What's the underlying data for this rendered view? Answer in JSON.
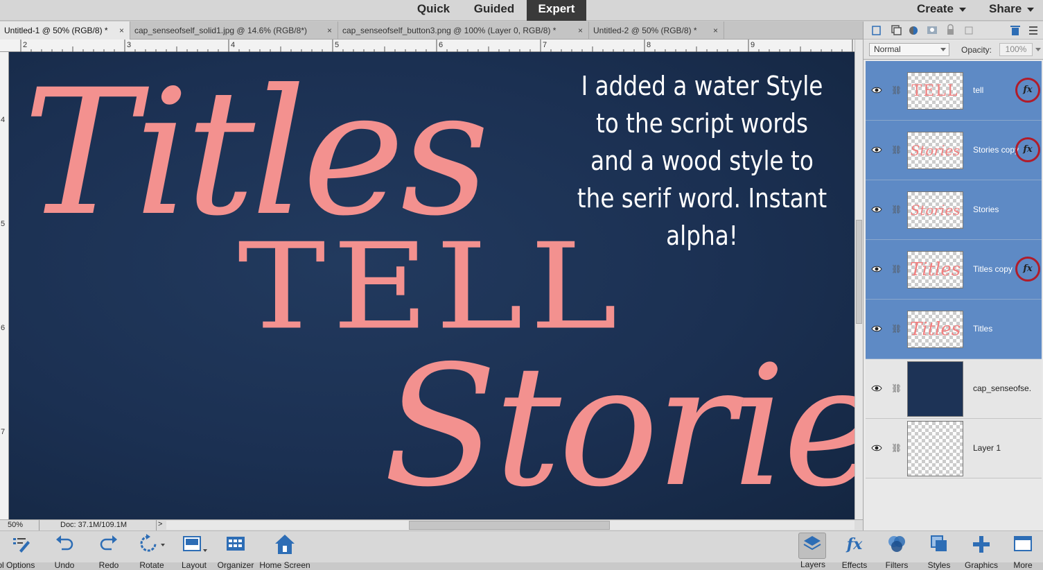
{
  "top": {
    "modes": [
      "Quick",
      "Guided",
      "Expert"
    ],
    "active_mode": "Expert",
    "create": "Create",
    "share": "Share"
  },
  "tabs": [
    {
      "label": "Untitled-1 @ 50% (RGB/8) *",
      "close": "×"
    },
    {
      "label": "cap_senseofself_solid1.jpg @ 14.6% (RGB/8*)",
      "close": "×"
    },
    {
      "label": "cap_senseofself_button3.png @ 100% (Layer 0, RGB/8) *",
      "close": "×"
    },
    {
      "label": "Untitled-2 @ 50% (RGB/8) *",
      "close": "×"
    }
  ],
  "ruler": {
    "top": [
      "2",
      "3",
      "4",
      "5",
      "6",
      "7",
      "8",
      "9"
    ],
    "left": [
      "4",
      "5",
      "6",
      "7"
    ]
  },
  "canvas": {
    "art_titles": "Titles",
    "art_tell": "TELL",
    "art_stories": "Stories",
    "annotation": "I added a water Style to the script words and a wood style to the serif word. Instant alpha!"
  },
  "status": {
    "zoom": "50%",
    "doc": "Doc: 37.1M/109.1M",
    "arrow": ">"
  },
  "layers_panel": {
    "blend_mode": "Normal",
    "opacity_label": "Opacity:",
    "opacity_value": "100%",
    "layers": [
      {
        "name": "tell",
        "thumb": "TELL",
        "selected": true,
        "fx": "fx"
      },
      {
        "name": "Stories copy",
        "thumb": "Stories",
        "selected": true,
        "fx": "fx"
      },
      {
        "name": "Stories",
        "thumb": "Stories",
        "selected": true,
        "fx": ""
      },
      {
        "name": "Titles copy",
        "thumb": "Titles",
        "selected": true,
        "fx": "fx"
      },
      {
        "name": "Titles",
        "thumb": "Titles",
        "selected": true,
        "fx": ""
      },
      {
        "name": "cap_senseofse...",
        "thumb": "",
        "selected": false,
        "fx": ""
      },
      {
        "name": "Layer 1",
        "thumb": "",
        "selected": false,
        "fx": ""
      }
    ]
  },
  "bottom_left": [
    {
      "label": "Tool Options",
      "icon": "tool-options-icon"
    },
    {
      "label": "Undo",
      "icon": "undo-icon"
    },
    {
      "label": "Redo",
      "icon": "redo-icon"
    },
    {
      "label": "Rotate",
      "icon": "rotate-icon"
    },
    {
      "label": "Layout",
      "icon": "layout-icon"
    },
    {
      "label": "Organizer",
      "icon": "organizer-icon"
    },
    {
      "label": "Home Screen",
      "icon": "home-icon"
    }
  ],
  "bottom_right": [
    {
      "label": "Layers",
      "icon": "layers-icon"
    },
    {
      "label": "Effects",
      "icon": "effects-icon"
    },
    {
      "label": "Filters",
      "icon": "filters-icon"
    },
    {
      "label": "Styles",
      "icon": "styles-icon"
    },
    {
      "label": "Graphics",
      "icon": "graphics-icon"
    },
    {
      "label": "More",
      "icon": "more-icon"
    }
  ],
  "colors": {
    "accent_selected_layer": "#5e8ac5",
    "canvas_background": "#1b3052",
    "text_pink": "#f3918f",
    "fx_highlight_ring": "#b01c2a",
    "icon_blue": "#2d6db5"
  }
}
